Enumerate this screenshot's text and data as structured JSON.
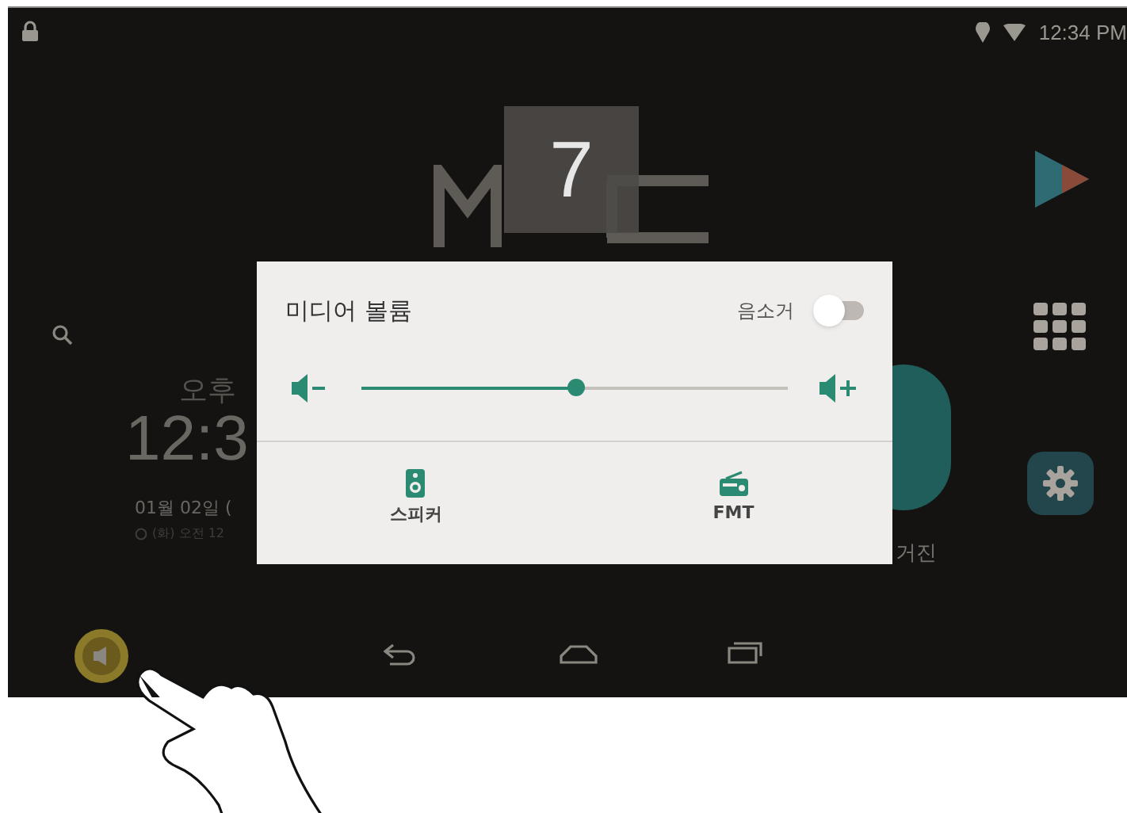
{
  "status_bar": {
    "time": "12:34 PM"
  },
  "home": {
    "logo_badge": "7",
    "clock": {
      "period": "오후",
      "time": "12:3",
      "date": "01월 02일 (",
      "alarm": "(화) 오전 12"
    },
    "app_label": "거진"
  },
  "dialog": {
    "title": "미디어 볼륨",
    "mute": {
      "label": "음소거",
      "on": false
    },
    "volume": {
      "level": 0.5
    },
    "outputs": [
      {
        "kind": "speaker",
        "label": "스피커"
      },
      {
        "kind": "radio",
        "label": "FMT"
      }
    ]
  },
  "nav": {
    "volume_pressed": true
  }
}
